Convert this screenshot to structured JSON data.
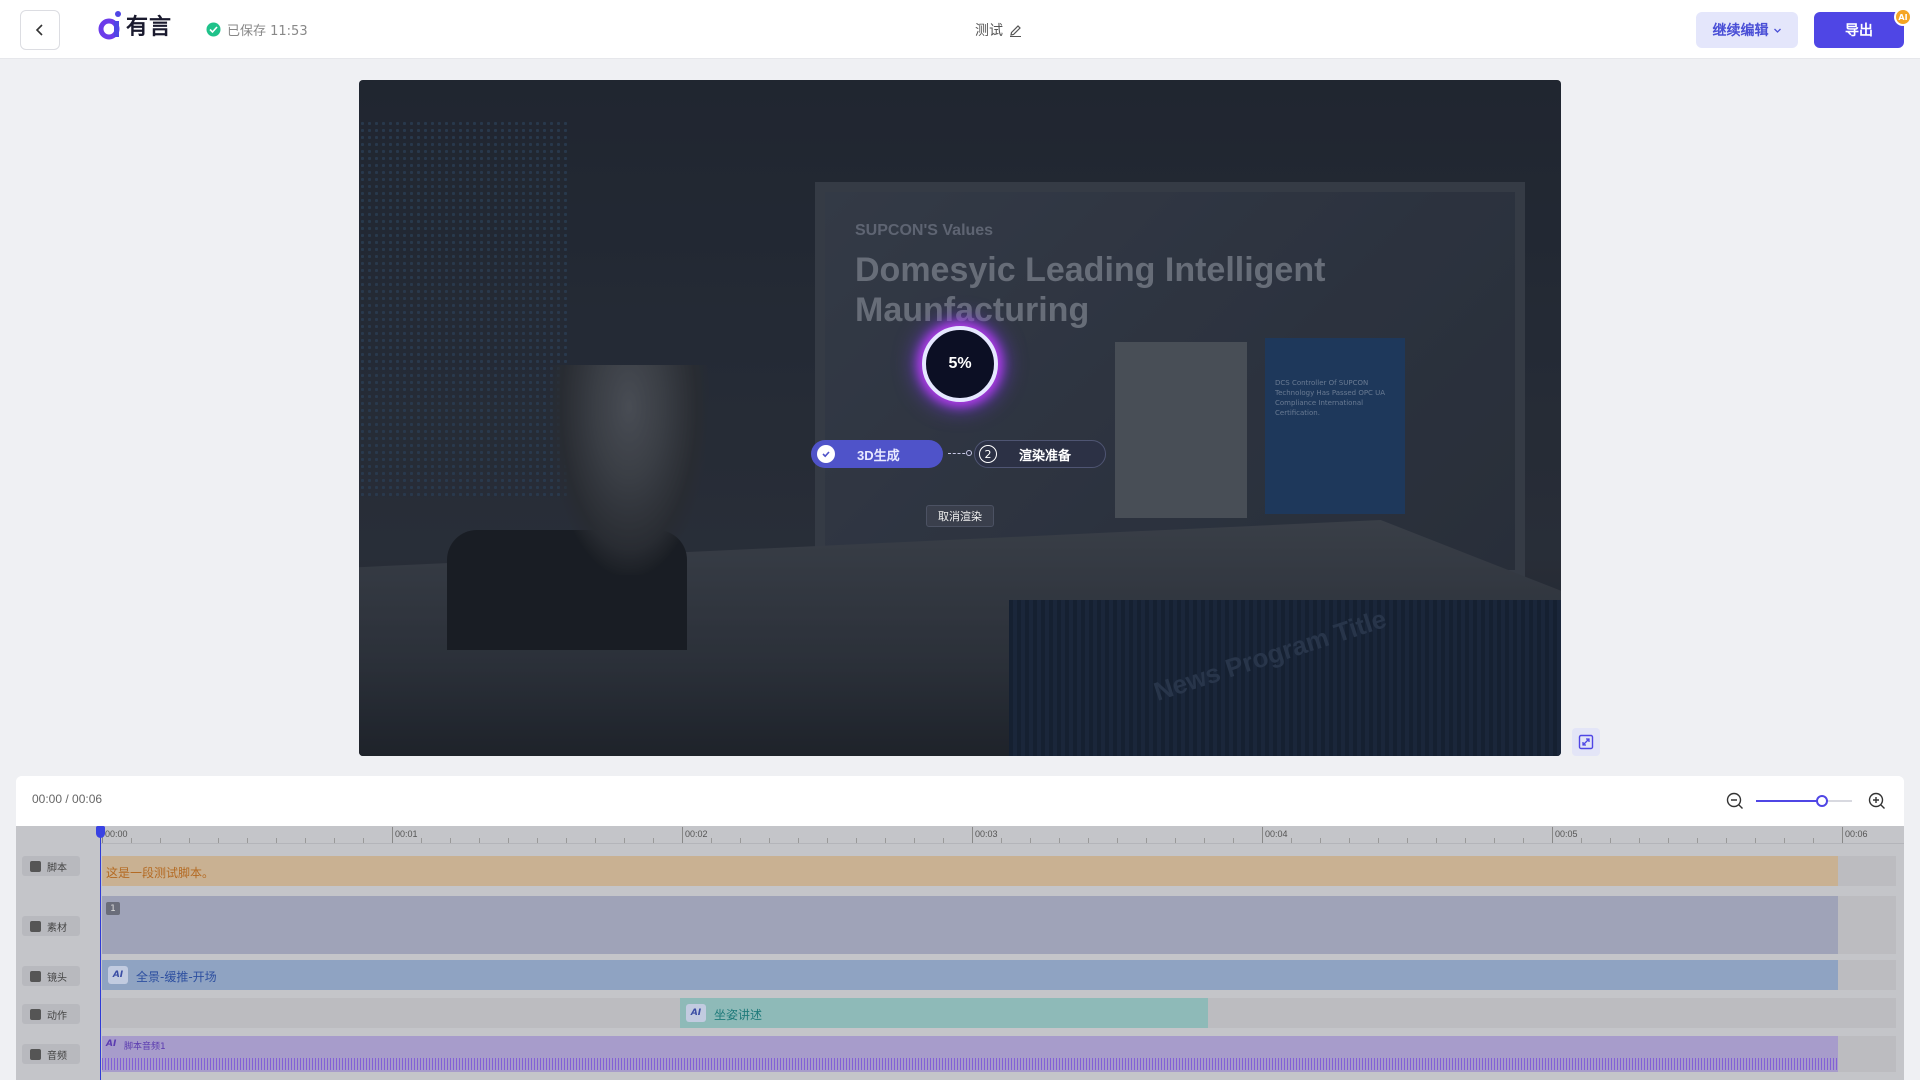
{
  "header": {
    "logo_text": "有言",
    "saved_status": "已保存 11:53",
    "doc_title": "测试",
    "continue_edit_label": "继续编辑",
    "export_label": "导出",
    "ai_badge": "AI"
  },
  "preview": {
    "screen_subtitle": "SUPCON'S Values",
    "screen_headline": "Domesyic Leading Intelligent Maunfacturing",
    "screen_card_text": "DCS Controller Of SUPCON Technology Has Passed OPC UA Compliance International Certification.",
    "desk_text": "News Program Title",
    "progress_text": "5%",
    "progress_value": 0.05,
    "step1_label": "3D生成",
    "step2_number": "2",
    "step2_label": "渲染准备",
    "cancel_label": "取消渲染"
  },
  "timeline": {
    "time_display": "00:00 / 00:06",
    "zoom_level": 0.85,
    "ruler_labels": [
      "00:00",
      "00:01",
      "00:02",
      "00:03",
      "00:04",
      "00:05",
      "00:06"
    ],
    "tracks": {
      "script_label": "脚本",
      "material_label": "素材",
      "camera_label": "镜头",
      "action_label": "动作",
      "audio_label": "音频"
    },
    "script_clip_text": "这是一段测试脚本。",
    "material_badge": "1",
    "camera_clip_text": "全景-缓推-开场",
    "action_clip_text": "坐姿讲述",
    "audio_clip_text": "脚本音频1",
    "ai_chip": "AI"
  },
  "icons": {
    "back": "chevron-left-icon",
    "saved": "check-circle-icon",
    "edit": "pencil-icon",
    "dropdown": "chevron-down-icon",
    "zoom_out": "zoom-out-icon",
    "zoom_in": "zoom-in-icon",
    "fit": "fit-screen-icon"
  },
  "colors": {
    "accent": "#4f46e5",
    "saved_green": "#1fc28a",
    "ring_glow": "#b33ce8"
  }
}
